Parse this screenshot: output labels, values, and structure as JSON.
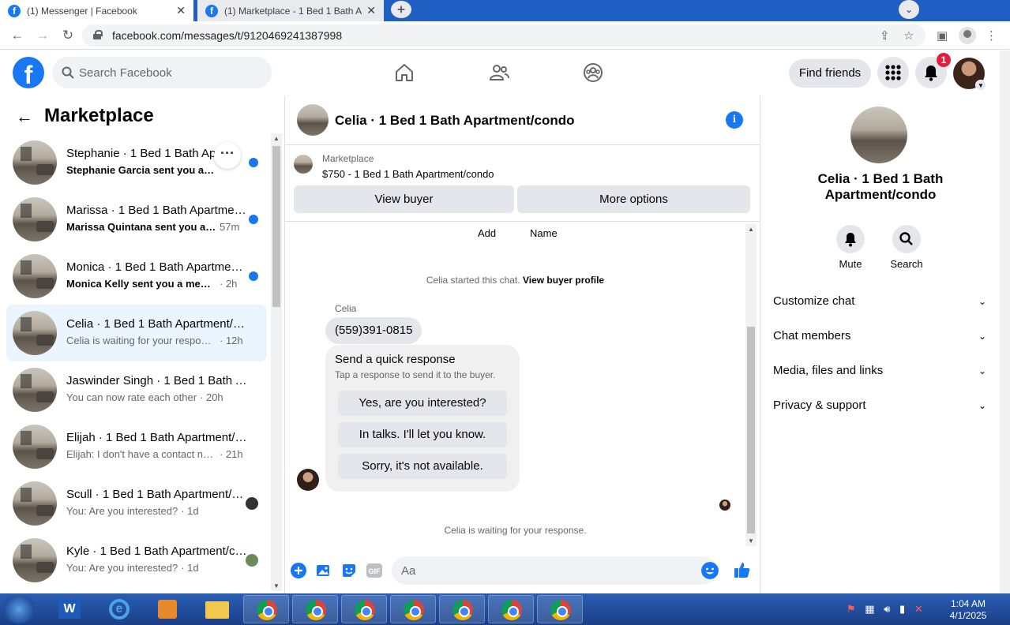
{
  "browser": {
    "tabs": [
      {
        "title": "(1) Messenger | Facebook",
        "active": true
      },
      {
        "title": "(1) Marketplace - 1 Bed 1 Bath Ap",
        "active": false
      }
    ],
    "url": "facebook.com/messages/t/9120469241387998"
  },
  "fb": {
    "logo": "f",
    "search_placeholder": "Search Facebook",
    "find_friends": "Find friends",
    "notif_count": "1"
  },
  "sidebar": {
    "title": "Marketplace",
    "conversations": [
      {
        "name": "Stephanie · 1 Bed 1 Bath Apartment/condo",
        "snippet": "Stephanie Garcia sent you a m...",
        "time": "",
        "unread": true
      },
      {
        "name": "Marissa · 1 Bed 1 Bath Apartment/condo",
        "snippet": "Marissa Quintana sent you a ...",
        "time": "57m",
        "unread": true
      },
      {
        "name": "Monica · 1 Bed 1 Bath Apartment/condo",
        "snippet": "Monica Kelly sent you a messag...",
        "time": "· 2h",
        "unread": true
      },
      {
        "name": "Celia · 1 Bed 1 Bath Apartment/condo",
        "snippet": "Celia is waiting for your response.",
        "time": "· 12h",
        "unread": false
      },
      {
        "name": "Jaswinder Singh · 1 Bed 1 Bath Apartment/condo",
        "snippet": "You can now rate each other",
        "time": "· 20h",
        "unread": false
      },
      {
        "name": "Elijah · 1 Bed 1 Bath Apartment/condo",
        "snippet": "Elijah: I don't have a contact num...",
        "time": "· 21h",
        "unread": false
      },
      {
        "name": "Scull · 1 Bed 1 Bath Apartment/condo",
        "snippet": "You: Are you interested?",
        "time": "· 1d",
        "unread": false
      },
      {
        "name": "Kyle · 1 Bed 1 Bath Apartment/condo",
        "snippet": "You: Are you interested?",
        "time": "· 1d",
        "unread": false
      }
    ]
  },
  "chat": {
    "title": "Celia · 1 Bed 1 Bath Apartment/condo",
    "info_glyph": "i",
    "listing_label": "Marketplace",
    "listing_detail": "$750 - 1 Bed 1 Bath Apartment/condo",
    "view_buyer": "View buyer",
    "more_options": "More options",
    "top_actions": [
      "Add",
      "Name"
    ],
    "started_text": "Celia started this chat.",
    "view_buyer_profile": "View buyer profile",
    "sender": "Celia",
    "message": "(559)391-0815",
    "quick_title": "Send a quick response",
    "quick_sub": "Tap a response to send it to the buyer.",
    "quick_responses": [
      "Yes, are you interested?",
      "In talks. I'll let you know.",
      "Sorry, it's not available."
    ],
    "waiting": "Celia is waiting for your response.",
    "composer_placeholder": "Aa",
    "gif_label": "GIF"
  },
  "details": {
    "name": "Celia · 1 Bed 1 Bath Apartment/condo",
    "actions": [
      "Mute",
      "Search"
    ],
    "sections": [
      "Customize chat",
      "Chat members",
      "Media, files and links",
      "Privacy & support"
    ]
  },
  "taskbar": {
    "time": "1:04 AM",
    "date": "4/1/2025"
  },
  "colors": {
    "fb_blue": "#1877f2",
    "badge_red": "#e41e3f",
    "selected_bg": "#ebf5ff"
  }
}
